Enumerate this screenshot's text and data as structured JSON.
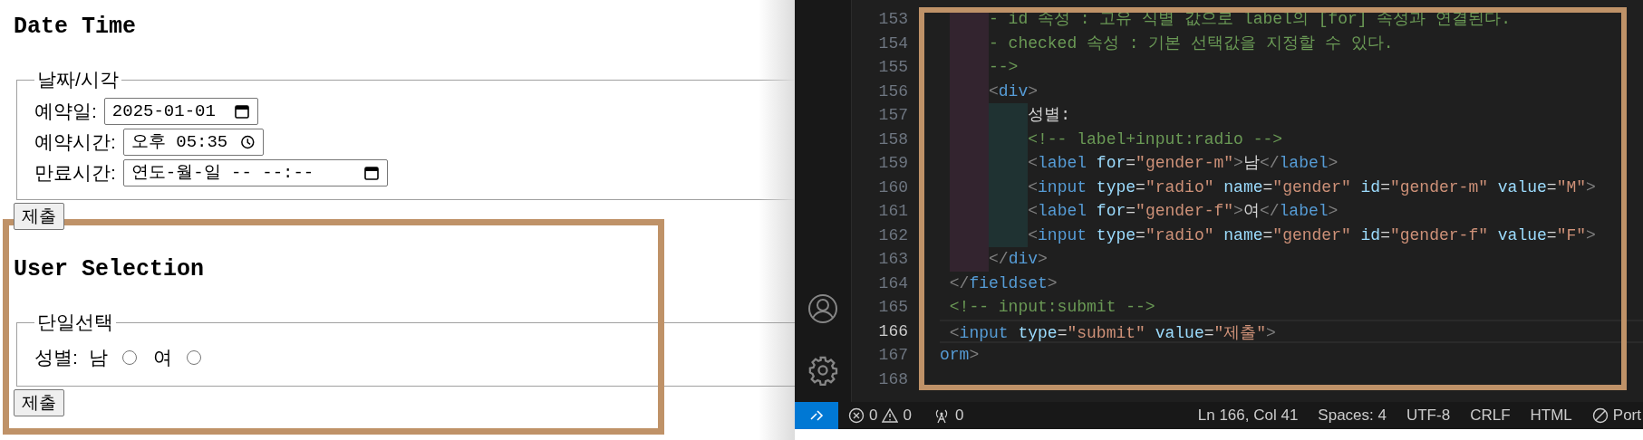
{
  "page": {
    "sections": [
      {
        "title": "Date Time",
        "legend": "날짜/시각",
        "highlighted": false,
        "fields": [
          {
            "kind": "date",
            "label": "예약일:",
            "value": "2025-01-01"
          },
          {
            "kind": "time",
            "label": "예약시간:",
            "value": "오후 05:35"
          },
          {
            "kind": "datetime",
            "label": "만료시간:",
            "value": "연도-월-일 -- --:--"
          }
        ],
        "submit": "제출"
      },
      {
        "title": "User Selection",
        "legend": "단일선택",
        "highlighted": true,
        "fields": [
          {
            "kind": "radio_group",
            "label": "성별:",
            "options": [
              {
                "label": "남",
                "checked": false
              },
              {
                "label": "여",
                "checked": false
              }
            ]
          }
        ],
        "submit": "제출"
      }
    ]
  },
  "editor": {
    "highlighted": true,
    "lines": [
      {
        "number": "153",
        "selected": false,
        "tokens": [
          {
            "kind": "comment",
            "text": "     - id 속성 : 고유 식별 값으로 label의 [for] 속성과 연결된다."
          }
        ]
      },
      {
        "number": "154",
        "selected": false,
        "tokens": [
          {
            "kind": "comment",
            "text": "     - checked 속성 : 기본 선택값을 지정할 수 있다."
          }
        ]
      },
      {
        "number": "155",
        "selected": false,
        "tokens": [
          {
            "kind": "comment",
            "text": "     -->"
          }
        ]
      },
      {
        "number": "156",
        "selected": false,
        "tokens": [
          {
            "kind": "bracket",
            "text": "     <"
          },
          {
            "kind": "tag",
            "text": "div"
          },
          {
            "kind": "bracket",
            "text": ">"
          }
        ]
      },
      {
        "number": "157",
        "selected": false,
        "tokens": [
          {
            "kind": "text",
            "text": "         성별:"
          }
        ]
      },
      {
        "number": "158",
        "selected": false,
        "tokens": [
          {
            "kind": "comment",
            "text": "         <!-- label+input:radio -->"
          }
        ]
      },
      {
        "number": "159",
        "selected": false,
        "tokens": [
          {
            "kind": "bracket",
            "text": "         <"
          },
          {
            "kind": "tag",
            "text": "label"
          },
          {
            "kind": "attr",
            "text": " for"
          },
          {
            "kind": "text",
            "text": "="
          },
          {
            "kind": "string",
            "text": "\"gender-m\""
          },
          {
            "kind": "bracket",
            "text": ">"
          },
          {
            "kind": "text",
            "text": "남"
          },
          {
            "kind": "bracket",
            "text": "</"
          },
          {
            "kind": "tag",
            "text": "label"
          },
          {
            "kind": "bracket",
            "text": ">"
          }
        ]
      },
      {
        "number": "160",
        "selected": false,
        "tokens": [
          {
            "kind": "bracket",
            "text": "         <"
          },
          {
            "kind": "tag",
            "text": "input"
          },
          {
            "kind": "attr",
            "text": " type"
          },
          {
            "kind": "text",
            "text": "="
          },
          {
            "kind": "string",
            "text": "\"radio\""
          },
          {
            "kind": "attr",
            "text": " name"
          },
          {
            "kind": "text",
            "text": "="
          },
          {
            "kind": "string",
            "text": "\"gender\""
          },
          {
            "kind": "attr",
            "text": " id"
          },
          {
            "kind": "text",
            "text": "="
          },
          {
            "kind": "string",
            "text": "\"gender-m\""
          },
          {
            "kind": "attr",
            "text": " value"
          },
          {
            "kind": "text",
            "text": "="
          },
          {
            "kind": "string",
            "text": "\"M\""
          },
          {
            "kind": "bracket",
            "text": ">"
          }
        ]
      },
      {
        "number": "161",
        "selected": false,
        "tokens": [
          {
            "kind": "bracket",
            "text": "         <"
          },
          {
            "kind": "tag",
            "text": "label"
          },
          {
            "kind": "attr",
            "text": " for"
          },
          {
            "kind": "text",
            "text": "="
          },
          {
            "kind": "string",
            "text": "\"gender-f\""
          },
          {
            "kind": "bracket",
            "text": ">"
          },
          {
            "kind": "text",
            "text": "여"
          },
          {
            "kind": "bracket",
            "text": "</"
          },
          {
            "kind": "tag",
            "text": "label"
          },
          {
            "kind": "bracket",
            "text": ">"
          }
        ]
      },
      {
        "number": "162",
        "selected": false,
        "tokens": [
          {
            "kind": "bracket",
            "text": "         <"
          },
          {
            "kind": "tag",
            "text": "input"
          },
          {
            "kind": "attr",
            "text": " type"
          },
          {
            "kind": "text",
            "text": "="
          },
          {
            "kind": "string",
            "text": "\"radio\""
          },
          {
            "kind": "attr",
            "text": " name"
          },
          {
            "kind": "text",
            "text": "="
          },
          {
            "kind": "string",
            "text": "\"gender\""
          },
          {
            "kind": "attr",
            "text": " id"
          },
          {
            "kind": "text",
            "text": "="
          },
          {
            "kind": "string",
            "text": "\"gender-f\""
          },
          {
            "kind": "attr",
            "text": " value"
          },
          {
            "kind": "text",
            "text": "="
          },
          {
            "kind": "string",
            "text": "\"F\""
          },
          {
            "kind": "bracket",
            "text": ">"
          }
        ]
      },
      {
        "number": "163",
        "selected": false,
        "tokens": [
          {
            "kind": "bracket",
            "text": "     </"
          },
          {
            "kind": "tag",
            "text": "div"
          },
          {
            "kind": "bracket",
            "text": ">"
          }
        ]
      },
      {
        "number": "164",
        "selected": false,
        "tokens": [
          {
            "kind": "bracket",
            "text": " </"
          },
          {
            "kind": "tag",
            "text": "fieldset"
          },
          {
            "kind": "bracket",
            "text": ">"
          }
        ]
      },
      {
        "number": "165",
        "selected": false,
        "tokens": [
          {
            "kind": "comment",
            "text": " <!-- input:submit -->"
          }
        ]
      },
      {
        "number": "166",
        "selected": true,
        "tokens": [
          {
            "kind": "bracket",
            "text": " <"
          },
          {
            "kind": "tag",
            "text": "input"
          },
          {
            "kind": "attr",
            "text": " type"
          },
          {
            "kind": "text",
            "text": "="
          },
          {
            "kind": "string",
            "text": "\"submit\""
          },
          {
            "kind": "attr",
            "text": " value"
          },
          {
            "kind": "text",
            "text": "="
          },
          {
            "kind": "string",
            "text": "\"제출\""
          },
          {
            "kind": "bracket",
            "text": ">"
          }
        ]
      },
      {
        "number": "167",
        "selected": false,
        "tokens": [
          {
            "kind": "tag",
            "text": "orm"
          },
          {
            "kind": "bracket",
            "text": ">"
          }
        ]
      },
      {
        "number": "168",
        "selected": false
      }
    ],
    "status_bar": {
      "errors": "0",
      "warnings": "0",
      "ports": "0",
      "position": "Ln 166, Col 41",
      "indent": "Spaces: 4",
      "encoding": "UTF-8",
      "eol": "CRLF",
      "language": "HTML",
      "ports_label": "Port"
    }
  }
}
